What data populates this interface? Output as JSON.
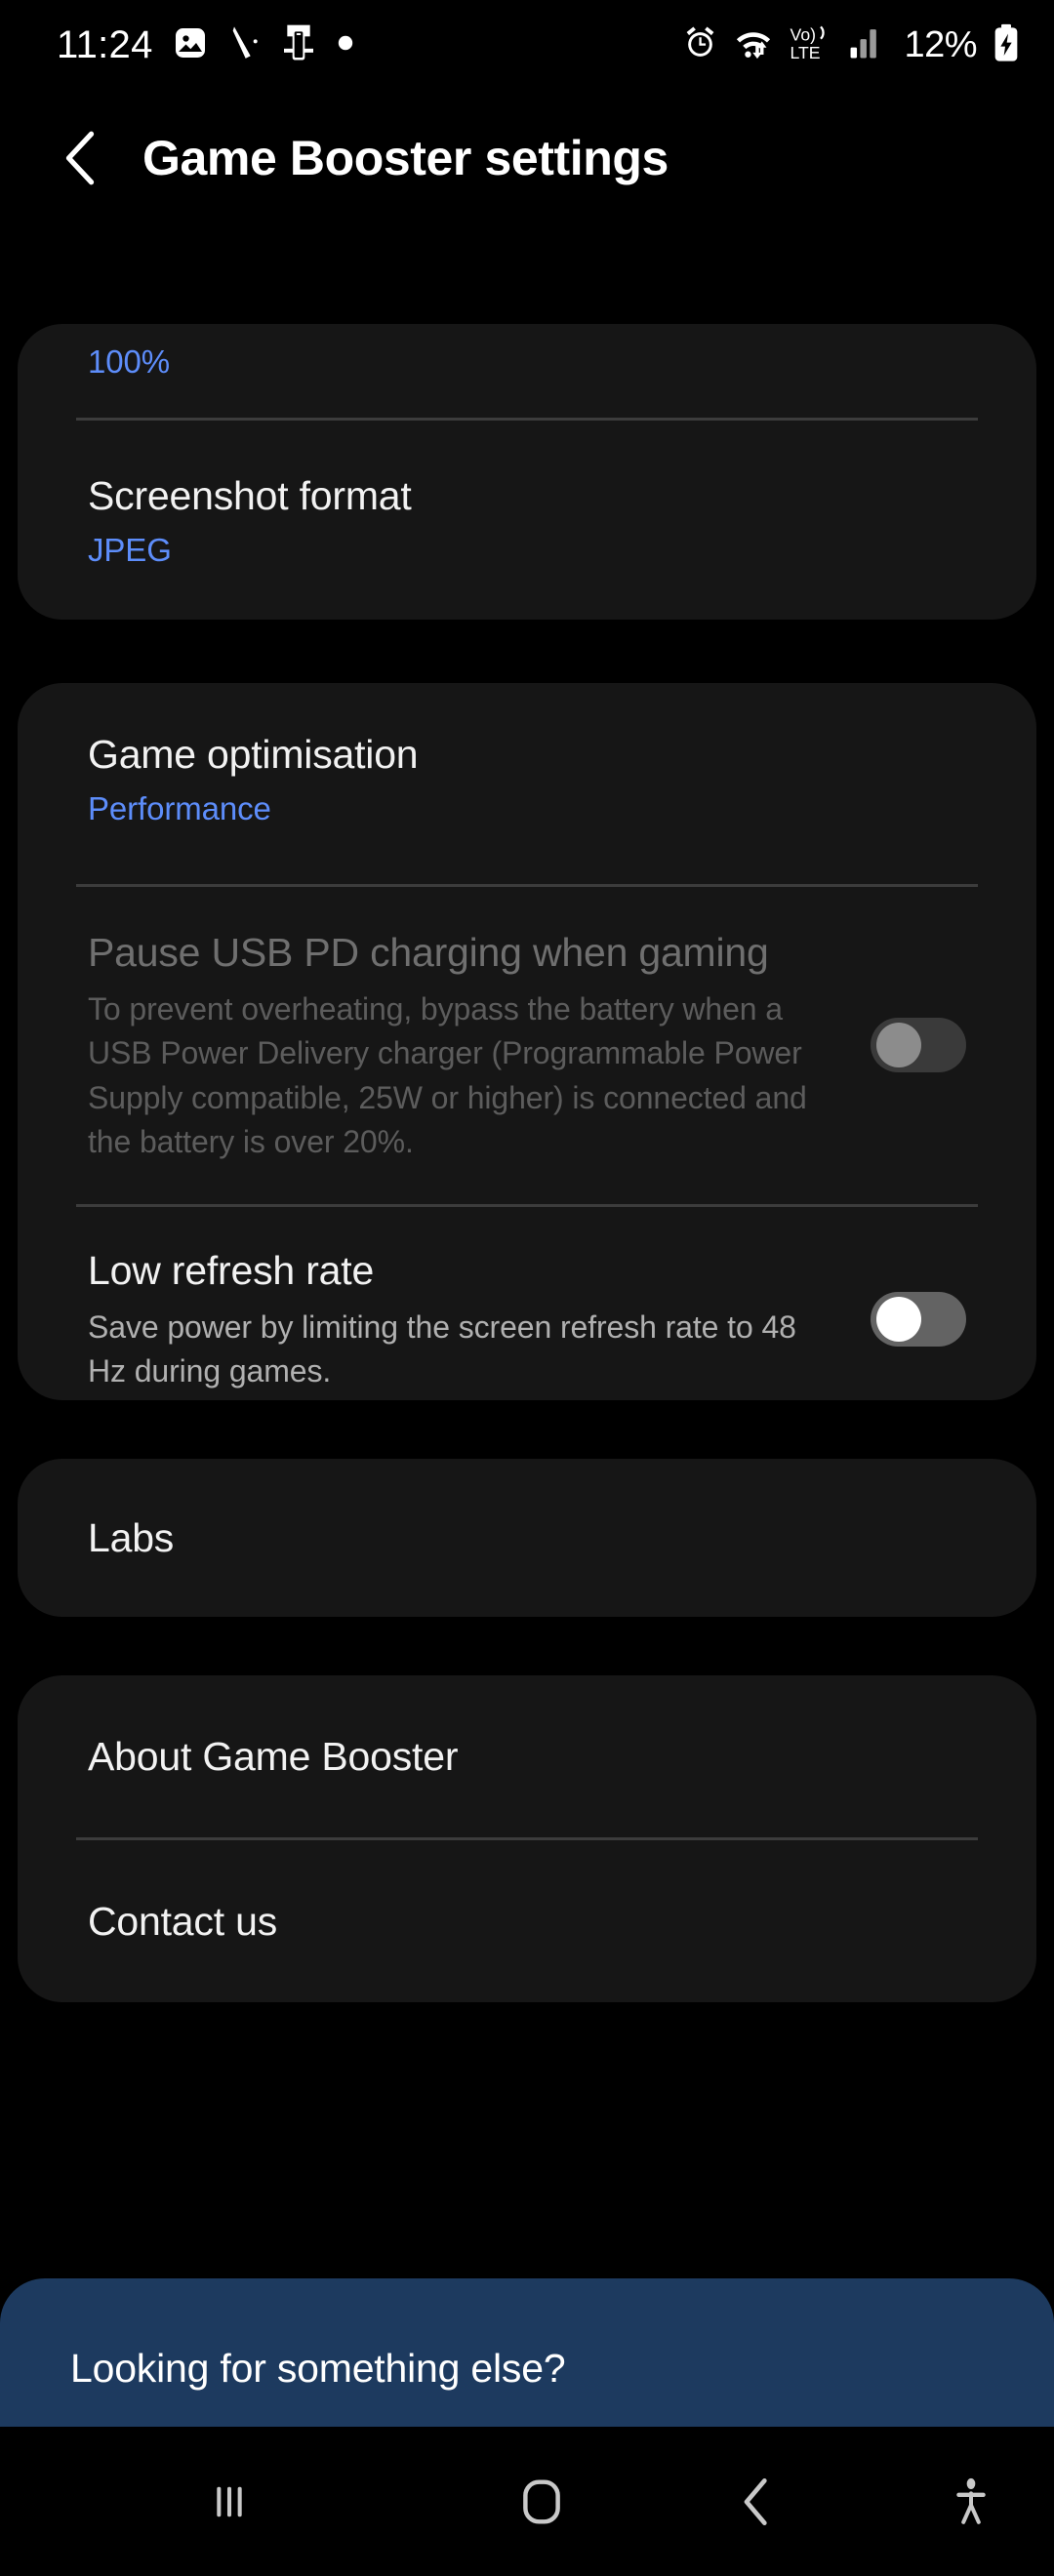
{
  "status_bar": {
    "time": "11:24",
    "battery_percent": "12%",
    "left_icons": [
      "image-icon",
      "stylus-icon",
      "phone-link-icon",
      "dot-icon"
    ],
    "right_icons": [
      "alarm-icon",
      "wifi-icon",
      "volte-icon",
      "signal-icon",
      "battery-charging-icon"
    ],
    "volte_label_top": "Vo)",
    "volte_label_bottom": "LTE"
  },
  "header": {
    "back_icon": "chevron-left-icon",
    "title": "Game Booster settings"
  },
  "cards": {
    "card_one": {
      "partial_value": "100%",
      "screenshot_format": {
        "title": "Screenshot format",
        "value": "JPEG"
      }
    },
    "card_two": {
      "game_optimisation": {
        "title": "Game optimisation",
        "value": "Performance"
      },
      "pause_usb_pd": {
        "title": "Pause USB PD charging when gaming",
        "description": "To prevent overheating, bypass the battery when a USB Power Delivery charger (Programmable Power Supply compatible, 25W or higher) is connected and the battery is over 20%.",
        "toggle_state": "off",
        "enabled": "false"
      },
      "low_refresh_rate": {
        "title": "Low refresh rate",
        "description": "Save power by limiting the screen refresh rate to 48 Hz during games.",
        "toggle_state": "off",
        "enabled": "true"
      }
    },
    "card_three": {
      "labs": "Labs"
    },
    "card_four": {
      "about": "About Game Booster",
      "contact": "Contact us"
    }
  },
  "banner": {
    "text": "Looking for something else?"
  },
  "nav_bar": {
    "recents_icon": "recents-icon",
    "home_icon": "home-icon",
    "back_icon": "back-icon",
    "accessibility_icon": "accessibility-icon"
  },
  "colors": {
    "accent_blue": "#5d8dfa",
    "card_bg": "#161616",
    "banner_bg": "#1d3a5f",
    "screen_bg": "#000000"
  }
}
